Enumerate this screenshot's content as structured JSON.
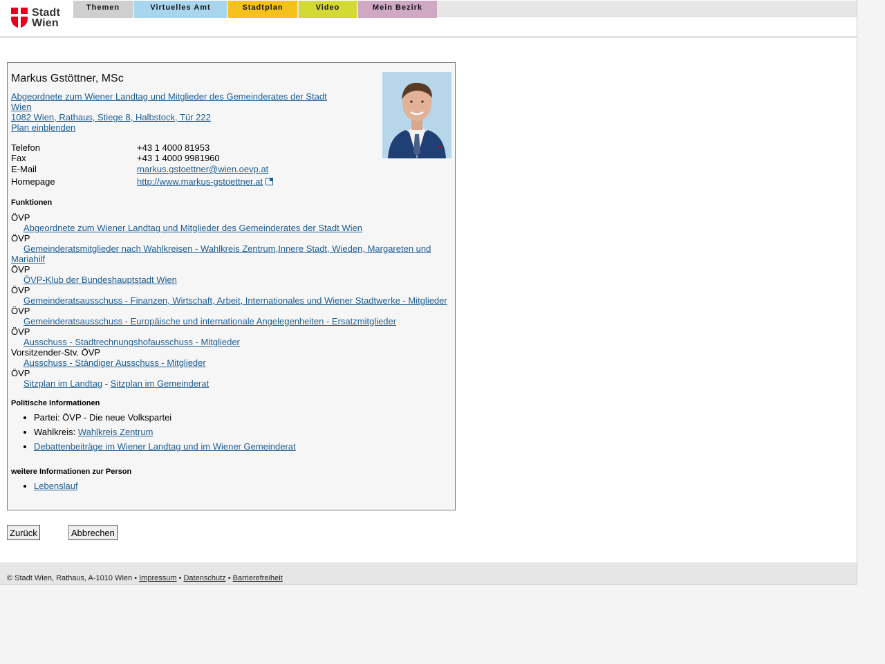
{
  "logo": {
    "line1": "Stadt",
    "line2": "Wien",
    "color": "#e2001a"
  },
  "nav": [
    "Themen",
    "Virtuelles Amt",
    "Stadtplan",
    "Video",
    "Mein Bezirk"
  ],
  "person": {
    "name": "Markus Gstöttner, MSc",
    "institution_line1": "Abgeordnete zum Wiener Landtag und Mitglieder des Gemeinderates der Stadt",
    "institution_line2": "Wien ",
    "address": "1082 Wien, Rathaus, Stiege 8, Halbstock, Tür 222",
    "map_link": "Plan einblenden"
  },
  "contact": {
    "phone_label": "Telefon",
    "phone": "+43 1 4000 81953",
    "fax_label": "Fax",
    "fax": "+43 1 4000 9981960",
    "email_label": "E-Mail",
    "email": "markus.gstoettner@wien.oevp.at",
    "homepage_label": "Homepage",
    "homepage": "http://www.markus-gstoettner.at"
  },
  "functions_heading": "Funktionen",
  "functions": [
    {
      "party": "ÖVP",
      "link": "Abgeordnete zum Wiener Landtag und Mitglieder des Gemeinderates der Stadt Wien"
    },
    {
      "party": "ÖVP",
      "link": "Gemeinderatsmitglieder nach Wahlkreisen - Wahlkreis Zentrum,Innere Stadt, Wieden, Margareten und Mariahilf"
    },
    {
      "party": "ÖVP",
      "link": "ÖVP-Klub der Bundeshauptstadt Wien"
    },
    {
      "party": "ÖVP",
      "link": "Gemeinderatsausschuss - Finanzen, Wirtschaft, Arbeit, Internationales und Wiener Stadtwerke - Mitglieder"
    },
    {
      "party": "ÖVP",
      "link": "Gemeinderatsausschuss - Europäische und internationale Angelegenheiten - Ersatzmitglieder"
    },
    {
      "party": "ÖVP",
      "link": "Ausschuss - Stadtrechnungshofausschuss - Mitglieder"
    },
    {
      "party": "Vorsitzender-Stv. ÖVP",
      "link": "Ausschuss - Ständiger Ausschuss - Mitglieder"
    }
  ],
  "seating": {
    "party": "ÖVP",
    "landtag": "Sitzplan im Landtag",
    "separator": " - ",
    "gemeinderat": "Sitzplan im Gemeinderat"
  },
  "political_heading": "Politische Informationen",
  "political": {
    "party_text": "Partei: ÖVP - Die neue Volkspartei",
    "district_label": "Wahlkreis: ",
    "district_link": "Wahlkreis Zentrum",
    "debates_link": "Debattenbeiträge im Wiener Landtag und im Wiener Gemeinderat"
  },
  "more_heading": "weitere Informationen zur Person",
  "more": {
    "cv_link": "Lebenslauf"
  },
  "buttons": {
    "back": "Zurück",
    "cancel": "Abbrechen"
  },
  "footer": {
    "copyright": "© Stadt Wien, Rathaus, A-1010 Wien • ",
    "impressum": "Impressum",
    "dot1": " • ",
    "privacy": "Datenschutz",
    "dot2": " • ",
    "accessibility": "Barrierefreiheit"
  }
}
